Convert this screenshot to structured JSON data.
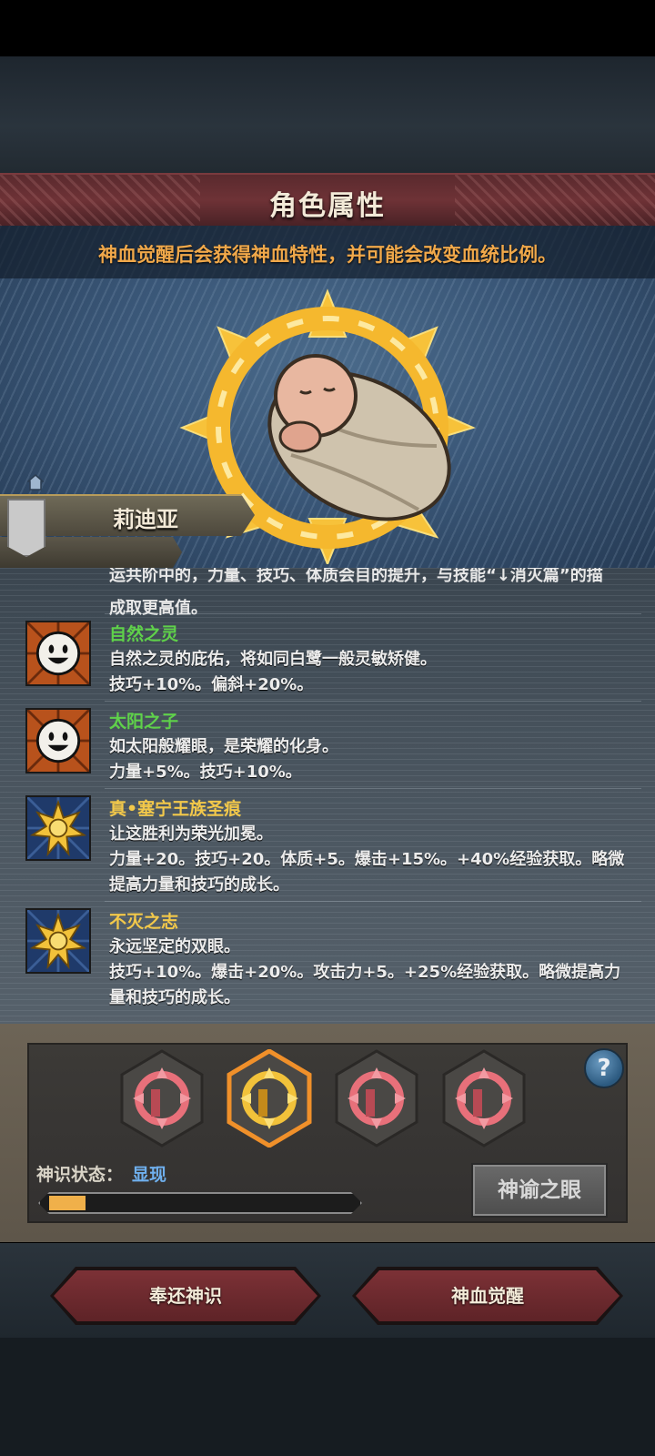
{
  "header": {
    "title": "角色属性",
    "subtitle": "神血觉醒后会获得神血特性，并可能会改变血统比例。"
  },
  "character": {
    "name": "莉迪亚"
  },
  "traits_list": {
    "clipped_top_line": "运共阶中的，力量、技巧、体质会目的提升，与技能“↓消灭篇”的描",
    "clipped_top_end": "成取更高值。",
    "items": [
      {
        "name": "自然之灵",
        "color": "green",
        "icon": "smiley-icon",
        "desc": "自然之灵的庇佑，将如同白鹭一般灵敏矫健。",
        "effects": "技巧+10%。偏斜+20%。"
      },
      {
        "name": "太阳之子",
        "color": "green",
        "icon": "smiley-icon",
        "desc": "如太阳般耀眼，是荣耀的化身。",
        "effects": "力量+5%。技巧+10%。"
      },
      {
        "name": "真•塞宁王族圣痕",
        "color": "yellow",
        "icon": "golden-sun-icon",
        "desc": "让这胜利为荣光加冕。",
        "effects": "力量+20。技巧+20。体质+5。爆击+15%。+40%经验获取。略微提高力量和技巧的成长。"
      },
      {
        "name": "不灭之志",
        "color": "yellow",
        "icon": "golden-sun-icon",
        "desc": "永远坚定的双眼。",
        "effects": "技巧+10%。爆击+20%。攻击力+5。+25%经验获取。略微提高力量和技巧的成长。"
      }
    ]
  },
  "divine_panel": {
    "status_label": "神识状态：",
    "status_value": "显现",
    "progress": 0.12,
    "oracle_button": "神谕之眼",
    "help_button": "?",
    "seals": [
      {
        "name": "seal-1",
        "active": false
      },
      {
        "name": "seal-2",
        "active": true
      },
      {
        "name": "seal-3",
        "active": false
      },
      {
        "name": "seal-4",
        "active": false
      }
    ]
  },
  "actions": {
    "return_button": "奉还神识",
    "awaken_button": "神血觉醒"
  },
  "colors": {
    "accent_gold": "#f0b04a",
    "status_blue": "#6fb0ee",
    "trait_green": "#5fd14a",
    "trait_yellow": "#f2c84a",
    "button_red": "#7c3136"
  }
}
